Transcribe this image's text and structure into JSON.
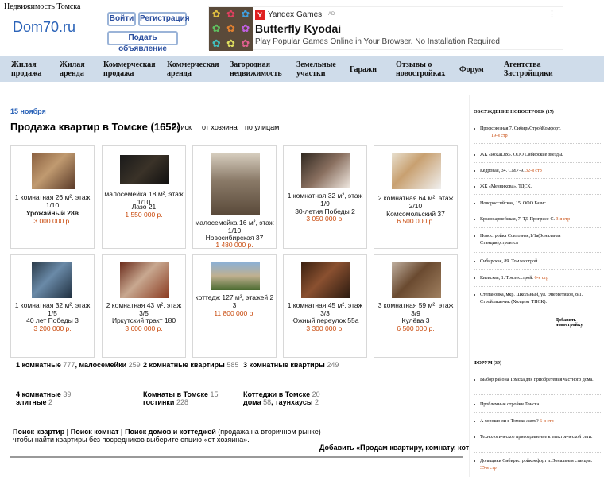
{
  "header": {
    "tagline": "Недвижимость Томска",
    "logo": "Dom70.ru",
    "login": "Войти",
    "register": "Регистрация",
    "post_ad": "Подать объявление"
  },
  "ad": {
    "brand": "Yandex Games",
    "label": "AD",
    "title": "Butterfly Kyodai",
    "description": "Play Popular Games Online in Your Browser. No Installation Required"
  },
  "nav": [
    {
      "l1": "Жилая",
      "l2": "продажа"
    },
    {
      "l1": "Жилая",
      "l2": "аренда"
    },
    {
      "l1": "Коммерческая",
      "l2": "продажа"
    },
    {
      "l1": "Коммерческая",
      "l2": "аренда"
    },
    {
      "l1": "Загородная",
      "l2": "недвижимость"
    },
    {
      "l1": "Земельные",
      "l2": "участки"
    },
    {
      "l1": "Гаражи",
      "l2": ""
    },
    {
      "l1": "Отзывы о",
      "l2": "новостройках"
    },
    {
      "l1": "Форум",
      "l2": ""
    },
    {
      "l1": "Агентства",
      "l2": "Застройщики"
    }
  ],
  "main": {
    "date": "15 ноября",
    "title": "Продажа квартир в Томске (1652)",
    "tabs": [
      "Поиск",
      "от хозяина",
      "по улицам"
    ],
    "listings": [
      {
        "t": "1 комнатная 26 м², этаж 1/10",
        "addr": "Урожайный 28в",
        "price": "3 000 000 р."
      },
      {
        "t": "малосемейка 18 м², этаж 1/10",
        "addr": "Лазо 21",
        "price": "1 550 000 р."
      },
      {
        "t": "малосемейка 16 м², этаж 1/10",
        "addr": "Новосибирская 37",
        "price": "1 480 000 р."
      },
      {
        "t": "1 комнатная 32 м², этаж 1/9",
        "addr": "30-летия Победы 2",
        "price": "3 050 000 р."
      },
      {
        "t": "2 комнатная 64 м², этаж 2/10",
        "addr": "Комсомольский 37",
        "price": "6 500 000 р."
      },
      {
        "t": "1 комнатная 32 м², этаж 1/5",
        "addr": "40 лет Победы 3",
        "price": "3 200 000 р."
      },
      {
        "t": "2 комнатная 43 м², этаж 3/5",
        "addr": "Иркутский тракт 180",
        "price": "3 600 000 р."
      },
      {
        "t": "коттедж 127 м², этажей 2",
        "addr": "3",
        "price": "11 800 000 р."
      },
      {
        "t": "1 комнатная 45 м², этаж 3/3",
        "addr": "Южный переулок 55а",
        "price": "3 300 000 р."
      },
      {
        "t": "3 комнатная 59 м², этаж 3/9",
        "addr": "Кулёва 3",
        "price": "6 500 000 р."
      }
    ],
    "categories": [
      {
        "a": "1 комнатные",
        "an": "777",
        "b": ", малосемейки",
        "bn": "259"
      },
      {
        "a": "2 комнатные квартиры",
        "an": "585",
        "b": "",
        "bn": ""
      },
      {
        "a": "3 комнатные квартиры",
        "an": "249",
        "b": "",
        "bn": ""
      },
      {
        "a": "4 комнатные",
        "an": "39",
        "b": "элитные",
        "bn": "2"
      },
      {
        "a": "Комнаты в Томске",
        "an": "15",
        "b": "гостинки",
        "bn": "228"
      },
      {
        "a": "Коттеджи в Томске",
        "an": "20",
        "b": "дома",
        "bn": "58",
        "c": ", таунхаусы",
        "cn": "2"
      }
    ],
    "search_links": "Поиск квартир | Поиск комнат | Поиск домов и коттеджей",
    "search_note": "(продажа на вторичном рынке)",
    "search_hint": "чтобы найти квартиры без посредников выберите опцию «от хозяина».",
    "add_link": "Добавить «Продам квартиру, комнату, коттедж»"
  },
  "sidebar": {
    "news_heading": "ОБСУЖДЕНИЕ НОВОСТРОЕК (17)",
    "news": [
      {
        "t": "Профсоюзная 7. СибирьСтройКомфорт.",
        "p": "19-я стр"
      },
      {
        "t": "ЖК «RozaLux». ООО Сибирские звёзды.",
        "p": ""
      },
      {
        "t": "Кедровая, 34. СМУ-9.",
        "p": "32-я стр"
      },
      {
        "t": "ЖК «Мечникова». ТДСК.",
        "p": ""
      },
      {
        "t": "Новороссийская, 15. ООО Базис.",
        "p": ""
      },
      {
        "t": "Красноармейская, 7. ТД Прогресс-С.",
        "p": "3-я стр"
      },
      {
        "t": "Новостройка Совхозная,1/1а(Зональная Станция),строится",
        "p": ""
      },
      {
        "t": "Сибирская, 89. Томлесстрой.",
        "p": ""
      },
      {
        "t": "Киевская, 1. Томлесстрой.",
        "p": "6-я стр"
      },
      {
        "t": "Степановка, мкр. Школьный, ул. Энергетиков, 8/1. Стройзаказчик (Холдинг ТПСК).",
        "p": ""
      }
    ],
    "add_building": "Добавить новостройку",
    "forum_heading": "ФОРУМ (39)",
    "forum": [
      {
        "t": "Выбор района Томска для приобретения частного дома.",
        "p": ""
      },
      {
        "t": "Проблемные стройки Томска.",
        "p": ""
      },
      {
        "t": "А хорошо ли в Томске жить?",
        "p": "6-я стр"
      },
      {
        "t": "Технологическое присоединение к электрической сети.",
        "p": ""
      },
      {
        "t": "Дольщики Сибирьстройкомфорт п. Зональная станция.",
        "p": "35-я стр"
      }
    ]
  }
}
